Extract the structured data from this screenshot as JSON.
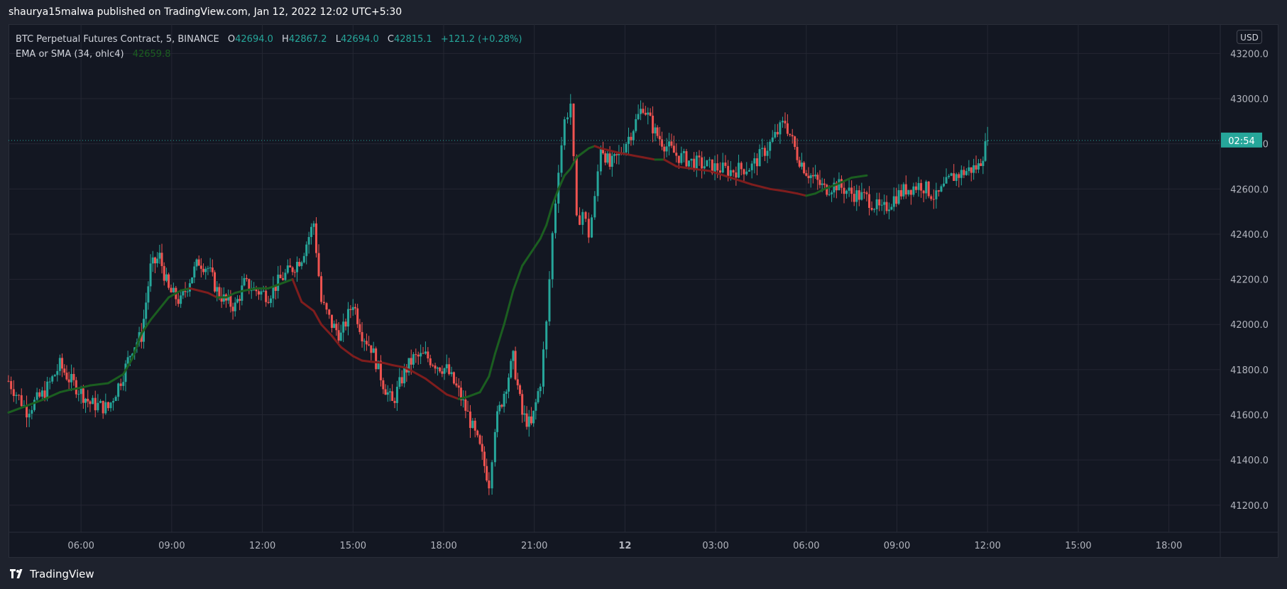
{
  "publish_line": "shaurya15malwa published on TradingView.com, Jan 12, 2022 12:02 UTC+5:30",
  "legend": {
    "symbol": "BTC Perpetual Futures Contract, 5, BINANCE",
    "open_label": "O",
    "open": "42694.0",
    "high_label": "H",
    "high": "42867.2",
    "low_label": "L",
    "low": "42694.0",
    "close_label": "C",
    "close": "42815.1",
    "change": "+121.2 (+0.28%)",
    "indicator_name": "EMA or SMA (34, ohlc4)",
    "indicator_value": "42659.8"
  },
  "currency": "USD",
  "countdown": "02:54",
  "brand": "TradingView",
  "colors": {
    "up": "#26a69a",
    "down": "#ef5350",
    "ma_up": "#1b5e20",
    "ma_down": "#7f1d1d",
    "background": "#131722",
    "grid": "#242733"
  },
  "chart_data": {
    "type": "candlestick",
    "title": "BTC Perpetual Futures Contract, 5, BINANCE",
    "xlabel": "",
    "ylabel": "",
    "ylim": [
      41080,
      43330
    ],
    "y_ticks": [
      "43200.0",
      "43000.0",
      "42800.0",
      "42600.0",
      "42400.0",
      "42200.0",
      "42000.0",
      "41800.0",
      "41600.0",
      "41400.0",
      "41200.0"
    ],
    "x_ticks": [
      "06:00",
      "09:00",
      "12:00",
      "15:00",
      "18:00",
      "21:00",
      "12",
      "03:00",
      "06:00",
      "09:00",
      "12:00",
      "15:00",
      "18:00"
    ],
    "x_tick_hours": [
      6,
      9,
      12,
      15,
      18,
      21,
      24,
      27,
      30,
      33,
      36,
      39,
      42
    ],
    "x_range_hours": [
      3.6,
      43.7
    ],
    "grid": true,
    "last_price": 42815.1,
    "series": [
      {
        "name": "Price",
        "x_hours": [
          3.6,
          4.2,
          4.8,
          5.3,
          5.6,
          6.0,
          6.3,
          6.9,
          7.4,
          7.7,
          8.0,
          8.3,
          8.6,
          8.9,
          9.3,
          9.6,
          9.9,
          10.2,
          10.5,
          10.8,
          11.1,
          11.4,
          11.8,
          12.2,
          12.6,
          13.0,
          13.3,
          13.7,
          13.95,
          14.3,
          14.6,
          15.0,
          15.3,
          15.6,
          16.0,
          16.3,
          16.7,
          17.0,
          17.4,
          17.8,
          18.1,
          18.5,
          18.8,
          19.2,
          19.5,
          19.7,
          20.0,
          20.3,
          20.6,
          20.9,
          21.2,
          21.4,
          21.6,
          21.8,
          22.0,
          22.2,
          22.4,
          22.6,
          22.8,
          23.0,
          23.2,
          23.5,
          23.8,
          24.2,
          24.6,
          25.0,
          25.3,
          25.7,
          26.2,
          26.8,
          27.5,
          28.2,
          28.8,
          29.3,
          29.7,
          30.0,
          30.3,
          30.6,
          31.0,
          31.5,
          32.0,
          32.5,
          32.9,
          33.3,
          33.8,
          34.3,
          34.8,
          35.3,
          35.7,
          36.0
        ],
        "close": [
          41750,
          41620,
          41700,
          41820,
          41760,
          41700,
          41650,
          41630,
          41780,
          41900,
          41950,
          42250,
          42300,
          42150,
          42100,
          42200,
          42280,
          42250,
          42150,
          42100,
          42080,
          42180,
          42150,
          42130,
          42200,
          42250,
          42300,
          42450,
          42100,
          42000,
          41950,
          42100,
          41960,
          41900,
          41740,
          41650,
          41790,
          41850,
          41860,
          41820,
          41800,
          41700,
          41600,
          41450,
          41300,
          41550,
          41700,
          41850,
          41600,
          41550,
          41750,
          42000,
          42400,
          42700,
          42900,
          42980,
          42450,
          42500,
          42400,
          42550,
          42800,
          42700,
          42750,
          42850,
          42970,
          42850,
          42800,
          42750,
          42720,
          42700,
          42680,
          42700,
          42800,
          42900,
          42750,
          42680,
          42640,
          42600,
          42620,
          42580,
          42560,
          42500,
          42560,
          42600,
          42620,
          42560,
          42650,
          42680,
          42700,
          42815
        ],
        "ma": [
          41610,
          41640,
          41670,
          41700,
          41710,
          41720,
          41730,
          41740,
          41780,
          41850,
          41960,
          42020,
          42070,
          42120,
          42150,
          42160,
          42150,
          42140,
          42120,
          42120,
          42140,
          42150,
          42160,
          42160,
          42180,
          42200,
          42100,
          42060,
          42000,
          41950,
          41900,
          41860,
          41840,
          41835,
          41830,
          41820,
          41810,
          41790,
          41760,
          41720,
          41690,
          41670,
          41680,
          41700,
          41770,
          41870,
          42000,
          42150,
          42260,
          42320,
          42380,
          42440,
          42530,
          42600,
          42660,
          42690,
          42740,
          42760,
          42780,
          42790,
          42780,
          42770,
          42760,
          42750,
          42740,
          42730,
          42730,
          42700,
          42690,
          42680,
          42650,
          42620,
          42600,
          42590,
          42580,
          42570,
          42580,
          42600,
          42620,
          42650,
          42659.8
        ]
      },
      {
        "name": "EMA or SMA (34, ohlc4)",
        "value": 42659.8
      }
    ]
  }
}
